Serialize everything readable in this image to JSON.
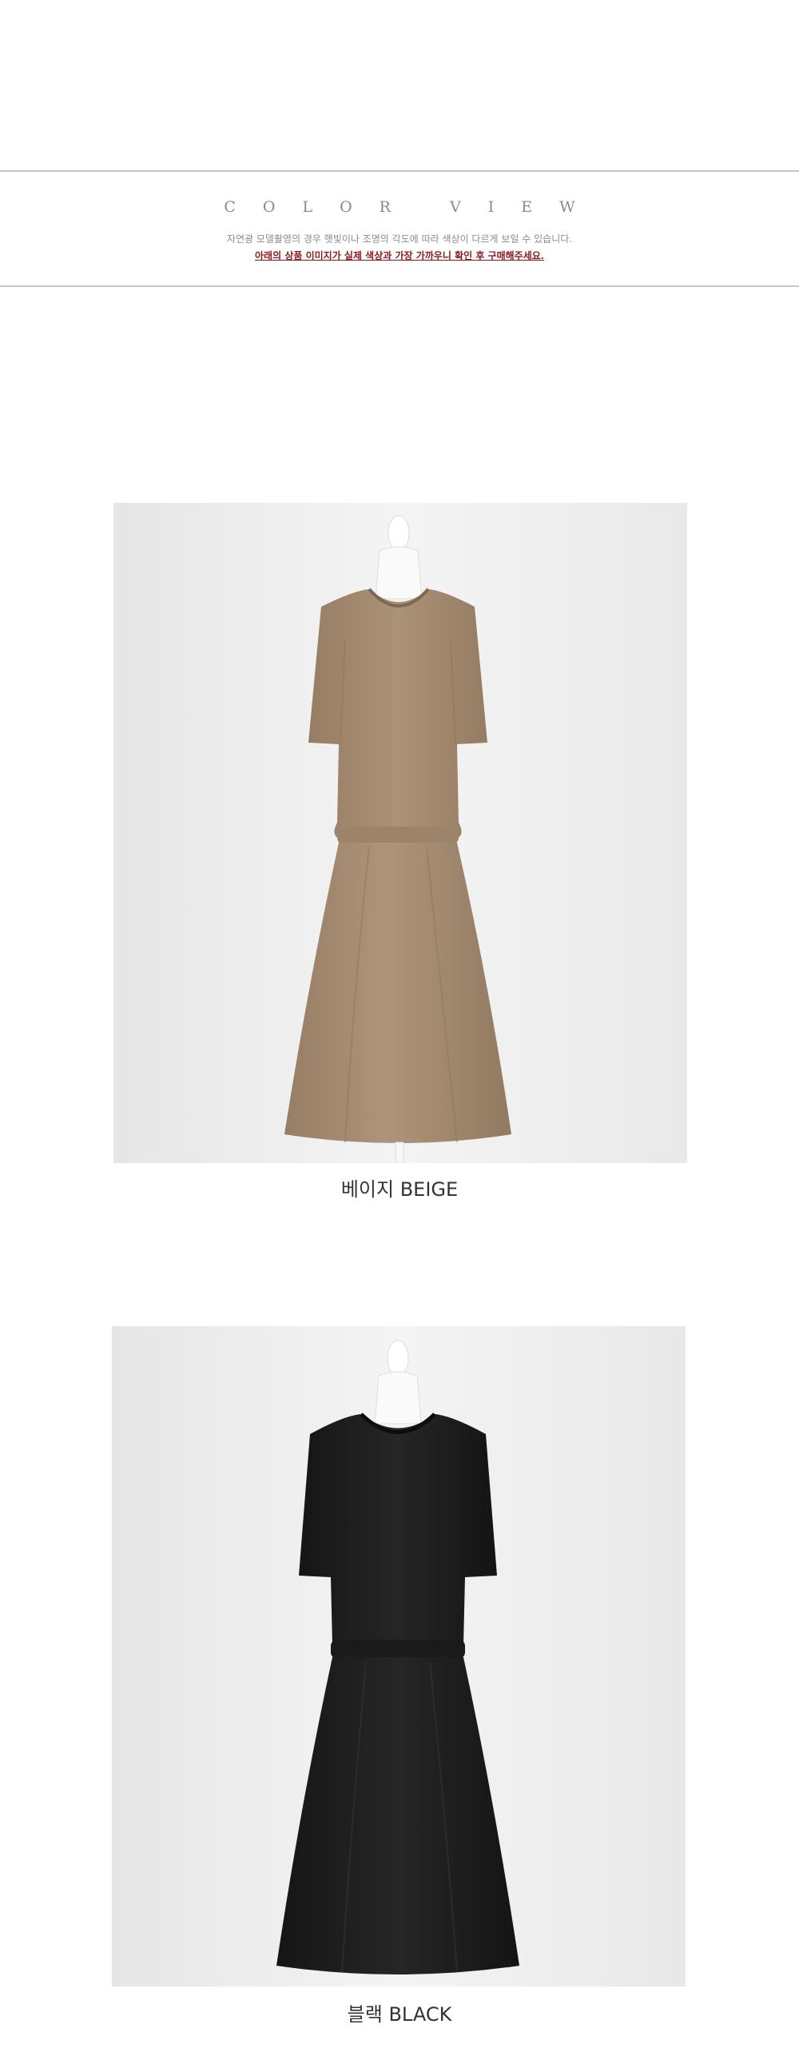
{
  "header": {
    "title": "COLOR VIEW",
    "note": "자연광 모델촬영의 경우 햇빛이나 조명의 각도에 따라 색상이 다르게 보일 수 있습니다.",
    "warning": "아래의 상품 이미지가 실제 색상과 가장 가까우니 확인 후 구매해주세요."
  },
  "products": [
    {
      "caption": "베이지 BEIGE",
      "garment_color": "#a68d72",
      "garment_shadow": "#8f775e",
      "background_color": "#efefef"
    },
    {
      "caption": "블랙 BLACK",
      "garment_color": "#1f1f1f",
      "garment_shadow": "#121212",
      "background_color": "#efefef"
    }
  ]
}
